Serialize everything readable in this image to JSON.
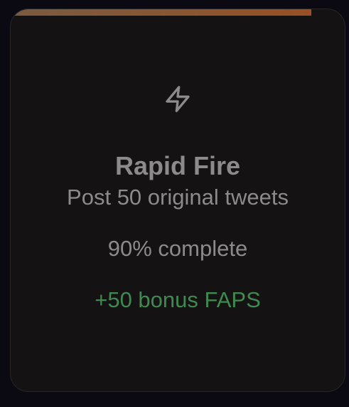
{
  "achievement": {
    "icon": "lightning-bolt-icon",
    "title": "Rapid Fire",
    "description": "Post 50 original tweets",
    "progress_percent": 90,
    "progress_label": "90% complete",
    "reward_label": "+50 bonus FAPS"
  },
  "colors": {
    "background": "#0b0a12",
    "card": "#141212",
    "text_muted": "#8c8a8a",
    "reward": "#3f8a50",
    "progress_bar": "#8a5630"
  }
}
